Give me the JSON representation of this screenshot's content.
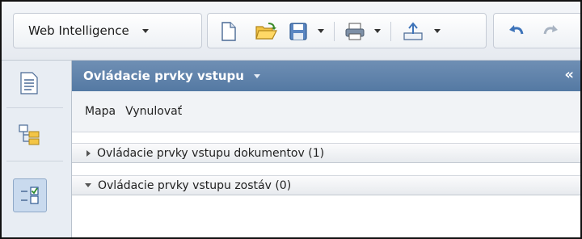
{
  "toolbar": {
    "app_menu_label": "Web Intelligence",
    "buttons": [
      {
        "name": "new-document",
        "icon": "new-document-icon"
      },
      {
        "name": "open",
        "icon": "open-folder-icon"
      },
      {
        "name": "save",
        "icon": "save-icon"
      },
      {
        "name": "print",
        "icon": "print-icon"
      },
      {
        "name": "export",
        "icon": "export-icon"
      },
      {
        "name": "undo",
        "icon": "undo-icon"
      },
      {
        "name": "redo",
        "icon": "redo-icon"
      }
    ]
  },
  "rail": {
    "items": [
      {
        "name": "document-summary",
        "icon": "document-summary-icon",
        "active": false
      },
      {
        "name": "navigation-map",
        "icon": "navigation-map-icon",
        "active": false
      },
      {
        "name": "input-controls",
        "icon": "input-controls-icon",
        "active": true
      }
    ]
  },
  "panel": {
    "title": "Ovládacie prvky vstupu",
    "collapse_glyph": "«",
    "menu": [
      "Mapa",
      "Vynulovať"
    ],
    "sections": [
      {
        "label": "Ovládacie prvky vstupu dokumentov (1)",
        "expanded": false
      },
      {
        "label": "Ovládacie prvky vstupu zostáv (0)",
        "expanded": true
      }
    ]
  },
  "colors": {
    "panel_header": "#5f82ac",
    "rail_bg": "#e8edf3",
    "toolbar_bg": "#eceff3",
    "accent_blue": "#3d73b9"
  }
}
